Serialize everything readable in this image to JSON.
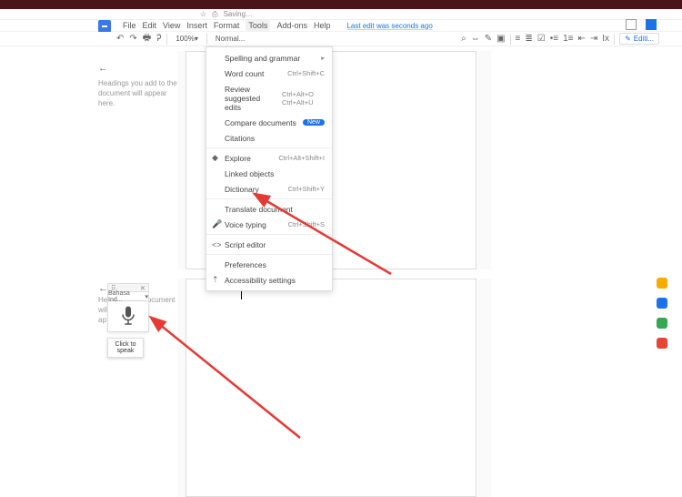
{
  "browser": {
    "saving": "Saving…"
  },
  "menubar": {
    "items": [
      "File",
      "Edit",
      "View",
      "Insert",
      "Format",
      "Tools",
      "Add-ons",
      "Help"
    ],
    "last_edit": "Last edit was seconds ago"
  },
  "toolbar": {
    "zoom": "100%",
    "style": "Normal...",
    "editing": "Editi..."
  },
  "outline": {
    "hint": "Headings you add to the document will appear here."
  },
  "tools_menu": {
    "items": [
      {
        "label": "Spelling and grammar",
        "shortcut": "",
        "arrow": true
      },
      {
        "label": "Word count",
        "shortcut": "Ctrl+Shift+C"
      },
      {
        "label": "Review suggested edits",
        "shortcut": "Ctrl+Alt+O Ctrl+Alt+U"
      },
      {
        "label": "Compare documents",
        "badge": "New"
      },
      {
        "label": "Citations",
        "shortcut": ""
      },
      {
        "sep": true
      },
      {
        "label": "Explore",
        "shortcut": "Ctrl+Alt+Shift+I",
        "icon": "◆"
      },
      {
        "label": "Linked objects",
        "shortcut": ""
      },
      {
        "label": "Dictionary",
        "shortcut": "Ctrl+Shift+Y"
      },
      {
        "sep": true
      },
      {
        "label": "Translate document",
        "shortcut": ""
      },
      {
        "label": "Voice typing",
        "shortcut": "Ctrl+Shift+S",
        "icon": "🎤"
      },
      {
        "sep": true
      },
      {
        "label": "Script editor",
        "shortcut": "",
        "icon": "<>"
      },
      {
        "sep": true
      },
      {
        "label": "Preferences",
        "shortcut": ""
      },
      {
        "label": "Accessibility settings",
        "shortcut": "",
        "icon": "⇡"
      }
    ]
  },
  "voice_typing": {
    "language": "Bahasa Ind...",
    "tooltip": "Click to speak"
  },
  "outline2": {
    "hint_pre": "He",
    "hint_mid": "the document will",
    "hint_post": "ap"
  },
  "side": {
    "c1": "#f9ab00",
    "c2": "#1a73e8",
    "c3": "#34a853",
    "c4": "#ea4335"
  }
}
